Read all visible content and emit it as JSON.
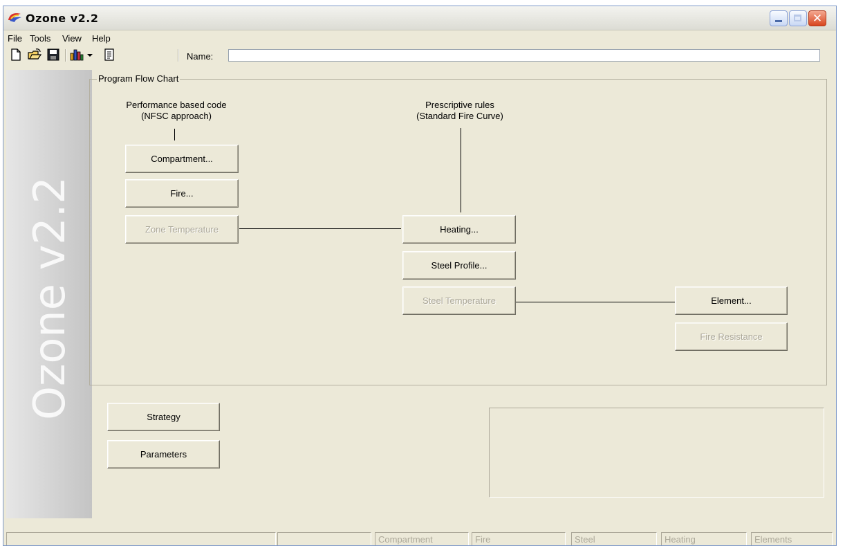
{
  "window": {
    "title": "Ozone v2.2"
  },
  "menu": [
    "File",
    "Tools",
    "View",
    "Help"
  ],
  "toolbar": {
    "name_label": "Name:",
    "name_value": "",
    "icons": [
      "new-file-icon",
      "open-folder-icon",
      "save-icon",
      "chart-icon",
      "dropdown-arrow-icon",
      "report-icon"
    ]
  },
  "sidebar": {
    "watermark": "Ozone v2.2"
  },
  "flowchart": {
    "group_title": "Program Flow Chart",
    "left_caption": [
      "Performance based code",
      "(NFSC approach)"
    ],
    "right_caption": [
      "Prescriptive rules",
      "(Standard Fire Curve)"
    ],
    "buttons": {
      "compartment": "Compartment...",
      "fire": "Fire...",
      "zone_temperature": "Zone Temperature",
      "heating": "Heating...",
      "steel_profile": "Steel Profile...",
      "steel_temperature": "Steel Temperature",
      "element": "Element...",
      "fire_resistance": "Fire Resistance"
    }
  },
  "bottom": {
    "strategy": "Strategy",
    "parameters": "Parameters"
  },
  "status": {
    "panels": [
      "",
      "",
      "Compartment",
      "Fire",
      "Steel",
      "Heating",
      "Elements"
    ]
  }
}
